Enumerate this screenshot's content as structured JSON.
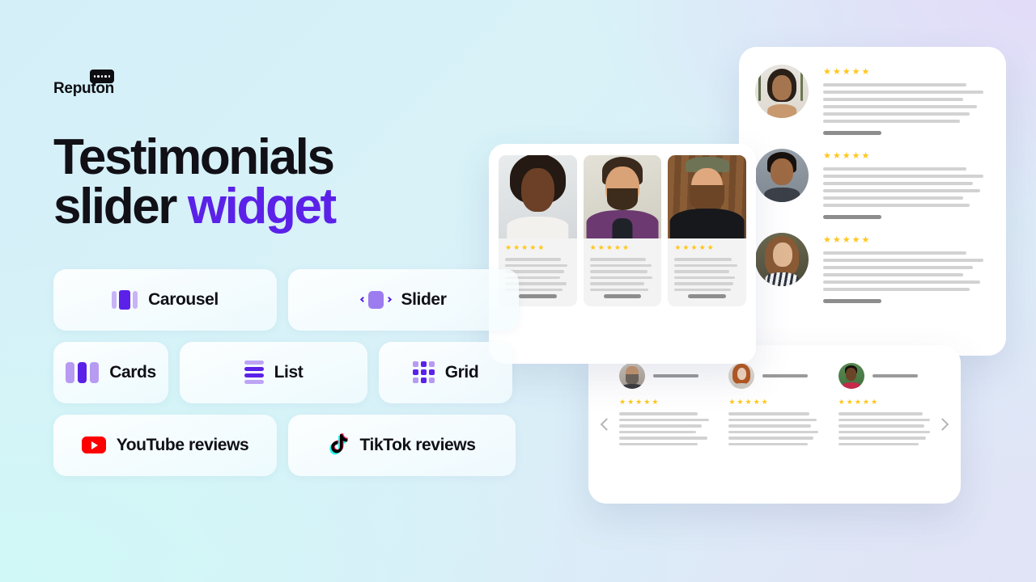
{
  "brand": {
    "name": "Reputon",
    "logo_icon": "speech-bubble-icon",
    "bubble_dots": 5
  },
  "headline": {
    "line1": "Testimonials",
    "line2_plain": "slider ",
    "line2_accent": "widget"
  },
  "colors": {
    "accent_purple": "#5B21E8",
    "accent_purple_light": "#b79bf2",
    "star_yellow": "#FFC61A",
    "youtube_red": "#FF0000",
    "tiktok_cyan": "#25F4EE",
    "tiktok_pink": "#FE2C55",
    "heading_black": "#111016",
    "bg_cyan": "#d5eff9",
    "bg_lavender": "#e3dbf8",
    "bg_mint": "#d0f8f7",
    "bg_periwinkle": "#e1e3f6"
  },
  "features": {
    "rows": [
      [
        {
          "label": "Carousel",
          "icon": "carousel-icon"
        },
        {
          "label": "Slider",
          "icon": "slider-icon"
        }
      ],
      [
        {
          "label": "Cards",
          "icon": "cards-icon"
        },
        {
          "label": "List",
          "icon": "list-icon"
        },
        {
          "label": "Grid",
          "icon": "grid-icon"
        }
      ],
      [
        {
          "label": "YouTube reviews",
          "icon": "youtube-icon"
        },
        {
          "label": "TikTok reviews",
          "icon": "tiktok-icon"
        }
      ]
    ]
  },
  "mockups": {
    "list_widget": {
      "name": "list-layout-preview",
      "rows": [
        {
          "avatar": "woman-palm-trees-avatar",
          "rating": 5,
          "line_count": 6,
          "has_name_bar": true
        },
        {
          "avatar": "man-smiling-avatar",
          "rating": 5,
          "line_count": 6,
          "has_name_bar": true
        },
        {
          "avatar": "woman-striped-shirt-avatar",
          "rating": 5,
          "line_count": 6,
          "has_name_bar": true
        }
      ]
    },
    "cards_widget": {
      "name": "cards-layout-preview",
      "cards": [
        {
          "photo": "woman-curly-hair-photo",
          "rating": 5,
          "line_count": 6,
          "has_name_bar": true
        },
        {
          "photo": "man-purple-sweater-photo",
          "rating": 5,
          "line_count": 6,
          "has_name_bar": true
        },
        {
          "photo": "bearded-man-cap-photo",
          "rating": 5,
          "line_count": 6,
          "has_name_bar": true
        }
      ]
    },
    "carousel_widget": {
      "name": "carousel-layout-preview",
      "prev_icon": "chevron-left-icon",
      "next_icon": "chevron-right-icon",
      "columns": [
        {
          "avatar": "bald-bearded-man-avatar",
          "rating": 5,
          "line_count": 6,
          "has_name_bar": true
        },
        {
          "avatar": "red-hair-woman-avatar",
          "rating": 5,
          "line_count": 6,
          "has_name_bar": true
        },
        {
          "avatar": "young-man-avatar",
          "rating": 5,
          "line_count": 6,
          "has_name_bar": true
        }
      ]
    },
    "star_glyph": "★"
  }
}
